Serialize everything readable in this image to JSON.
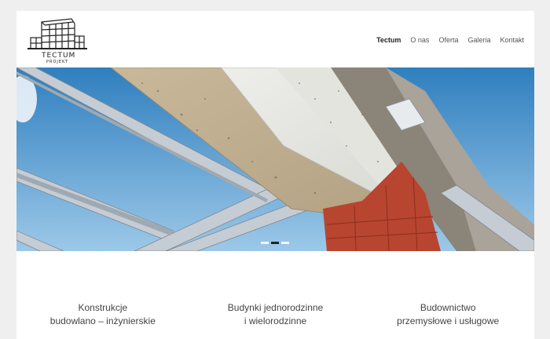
{
  "brand": {
    "logo_name": "TECTUM",
    "logo_sub": "PROJEKT"
  },
  "nav": {
    "items": [
      {
        "label": "Tectum",
        "active": true
      },
      {
        "label": "O nas",
        "active": false
      },
      {
        "label": "Oferta",
        "active": false
      },
      {
        "label": "Galeria",
        "active": false
      },
      {
        "label": "Kontakt",
        "active": false
      }
    ]
  },
  "slider": {
    "slide_count": 3,
    "active_index": 1
  },
  "features": [
    {
      "line1": "Konstrukcje",
      "line2": "budowlano – inżynierskie"
    },
    {
      "line1": "Budynki jednorodzinne",
      "line2": "i wielorodzinne"
    },
    {
      "line1": "Budownictwo",
      "line2": "przemysłowe i usługowe"
    }
  ],
  "colors": {
    "page_bg": "#efefef",
    "sky_top": "#2f7fbf",
    "sky_bottom": "#9cc8e8",
    "brick": "#b8452f"
  }
}
